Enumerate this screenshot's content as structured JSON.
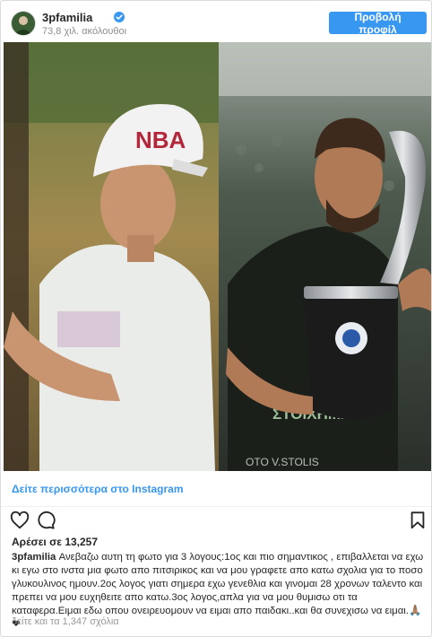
{
  "header": {
    "username": "3pfamilia",
    "followers": "73,8 χιλ. ακόλουθοι",
    "profile_button": "Προβολή προφίλ"
  },
  "photo": {
    "left_cap_text": "NBA",
    "shirt_text": "ΣΤΟΙΧΗΜΑ",
    "watermark": "OTO V.STOLIS"
  },
  "see_more": "Δείτε περισσότερα στο Instagram",
  "actions": {
    "icons": [
      "heart-icon",
      "comment-icon",
      "bookmark-icon"
    ]
  },
  "likes": "Αρέσει σε 13,257",
  "caption": {
    "username": "3pfamilia",
    "text": "Ανεβαζω αυτη τη φωτο για 3 λογους:1ος και πιο σημαντικος , επιβαλλεται να εχω κι εγω στο ινστα μια φωτο απο πιτσιρικος και να μου γραφετε απο κατω σχολια για το ποσο γλυκουλινος ημουν.2ος λογος γιατι σημερα εχω γενεθλια και γινομαι 28 χρονων ταλεντο και πρεπει να μου ευχηθειτε απο κατω.3ος λογος,απλα για να μου θυμισω οτι τα καταφερα.Ειμαι εδω οπου ονειρευομουν να ειμαι απο παιδακι..και θα συνεχισω να ειμαι.🙏🏽❤"
  },
  "comments_link": "δείτε και τα 1,347 σχόλια"
}
